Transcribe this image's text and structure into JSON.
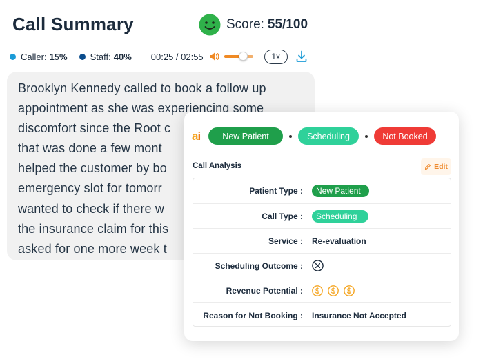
{
  "header": {
    "title": "Call Summary",
    "score_label": "Score:",
    "score_value": "55/100",
    "smiley_icon": "smiley-face-icon",
    "smiley_color": "#2fb14a"
  },
  "player": {
    "caller_label": "Caller:",
    "caller_value": "15%",
    "caller_color": "#1b9bd7",
    "staff_label": "Staff:",
    "staff_value": "40%",
    "staff_color": "#0a4c8c",
    "time": "00:25 / 02:55",
    "volume_level": 0.75,
    "speed": "1x",
    "accent": "#f08a24"
  },
  "transcript": {
    "lines": [
      "Brooklyn Kennedy called to book a follow up",
      "appointment as she was experiencing some",
      "discomfort since the Root c",
      "that was done a few mont",
      "helped the customer by bo",
      "emergency slot for tomorr",
      "wanted to check if there w",
      "the insurance claim for this",
      "asked for one more week t"
    ]
  },
  "analysis": {
    "logo_a": "a",
    "logo_i": "i",
    "tags": [
      "New Patient",
      "Scheduling",
      "Not Booked"
    ],
    "title": "Call Analysis",
    "edit_label": "Edit",
    "rows": [
      {
        "label": "Patient Type :",
        "value": "New Patient"
      },
      {
        "label": "Call Type :",
        "value": "Scheduling"
      },
      {
        "label": "Service :",
        "value": "Re-evaluation"
      },
      {
        "label": "Scheduling Outcome :",
        "value_icon": "circle-x-icon"
      },
      {
        "label": "Revenue Potential :",
        "value_icon": "dollar-coin-icon",
        "level": 3
      },
      {
        "label": "Reason for Not Booking :",
        "value": "Insurance Not Accepted"
      }
    ],
    "colors": {
      "new_patient": "#1f9f4b",
      "scheduling": "#2fd19a",
      "not_booked": "#ef3b36",
      "coin": "#f5a623"
    }
  }
}
